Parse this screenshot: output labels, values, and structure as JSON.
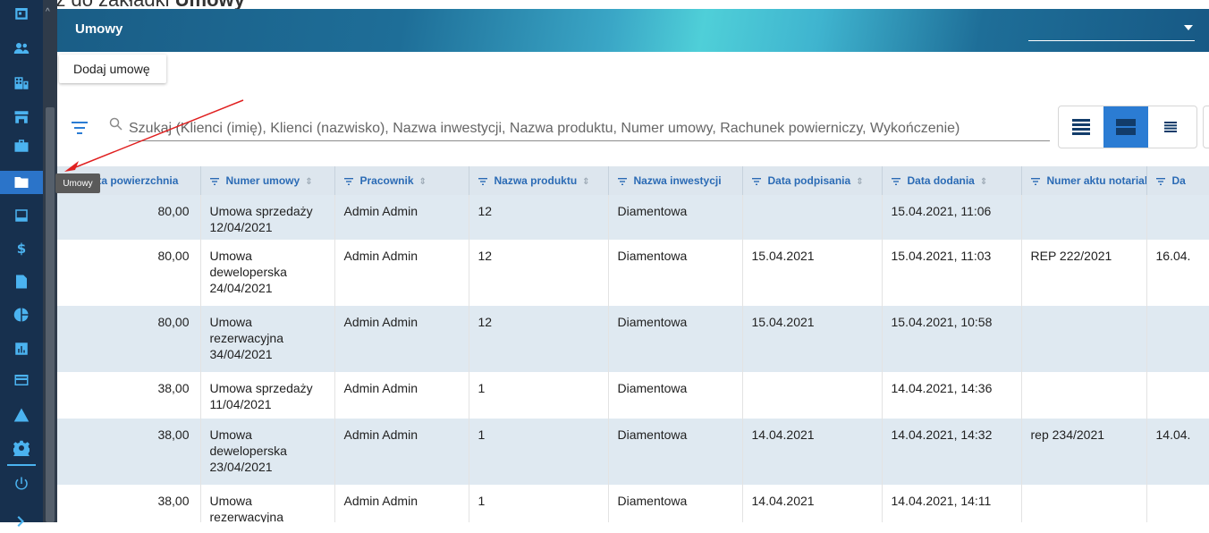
{
  "caption": {
    "prefix": "Przejdź do zakładki ",
    "bold": "Umowy"
  },
  "sidebar": {
    "items": [
      "calendar-icon",
      "users-icon",
      "buildings-icon",
      "store-icon",
      "briefcase-icon",
      "folder-icon",
      "inbox-icon",
      "dollar-icon",
      "document-icon",
      "pie-chart-icon",
      "bar-chart-icon",
      "card-icon",
      "warning-icon",
      "gear-icon",
      "power-icon"
    ],
    "active": "folder-icon",
    "accent": "#4bb3f0",
    "active_bg": "#2b74c9"
  },
  "tooltip": "Umowy",
  "header": {
    "title": "Umowy",
    "select_value": ""
  },
  "toolbar": {
    "add_label": "Dodaj umowę"
  },
  "search": {
    "placeholder": "Szukaj (Klienci (imię), Klienci (nazwisko), Nazwa inwestycji, Nazwa produktu, Numer umowy, Rachunek powierniczy, Wykończenie)"
  },
  "table": {
    "columns": [
      "Całkowita powierzchnia",
      "Numer umowy",
      "Pracownik",
      "Nazwa produktu",
      "Nazwa inwestycji",
      "Data podpisania",
      "Data dodania",
      "Numer aktu notarialnego",
      "Da"
    ],
    "rows": [
      {
        "area": "80,00",
        "number": "Umowa sprzedaży 12/04/2021",
        "employee": "Admin Admin",
        "product": "12",
        "investment": "Diamentowa",
        "signed": "",
        "added": "15.04.2021, 11:06",
        "notary": "",
        "extra": ""
      },
      {
        "area": "80,00",
        "number": "Umowa deweloperska 24/04/2021",
        "employee": "Admin Admin",
        "product": "12",
        "investment": "Diamentowa",
        "signed": "15.04.2021",
        "added": "15.04.2021, 11:03",
        "notary": "REP 222/2021",
        "extra": "16.04."
      },
      {
        "area": "80,00",
        "number": "Umowa rezerwacyjna 34/04/2021",
        "employee": "Admin Admin",
        "product": "12",
        "investment": "Diamentowa",
        "signed": "15.04.2021",
        "added": "15.04.2021, 10:58",
        "notary": "",
        "extra": ""
      },
      {
        "area": "38,00",
        "number": "Umowa sprzedaży 11/04/2021",
        "employee": "Admin Admin",
        "product": "1",
        "investment": "Diamentowa",
        "signed": "",
        "added": "14.04.2021, 14:36",
        "notary": "",
        "extra": ""
      },
      {
        "area": "38,00",
        "number": "Umowa deweloperska 23/04/2021",
        "employee": "Admin Admin",
        "product": "1",
        "investment": "Diamentowa",
        "signed": "14.04.2021",
        "added": "14.04.2021, 14:32",
        "notary": "rep 234/2021",
        "extra": "14.04."
      },
      {
        "area": "38,00",
        "number": "Umowa rezerwacyjna",
        "employee": "Admin Admin",
        "product": "1",
        "investment": "Diamentowa",
        "signed": "14.04.2021",
        "added": "14.04.2021, 14:11",
        "notary": "",
        "extra": ""
      }
    ]
  },
  "annotation": {
    "color": "#e02020"
  }
}
